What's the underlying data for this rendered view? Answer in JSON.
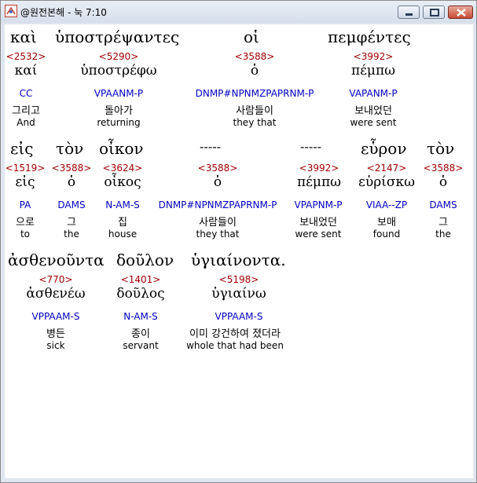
{
  "window": {
    "title": "@원전본해 - 눅 7:10",
    "buttons": {
      "minimize": "minimize",
      "maximize": "maximize",
      "close": "close"
    }
  },
  "rows": [
    {
      "words": [
        {
          "surface": "καὶ",
          "strong": "<2532>",
          "lemma": "καί",
          "morph": "CC",
          "korean": "그리고",
          "english": "And"
        },
        {
          "surface": "ὑποστρέψαντες",
          "strong": "<5290>",
          "lemma": "ὑποστρέφω",
          "morph": "VPAANM-P",
          "korean": "돌아가",
          "english": "returning"
        },
        {
          "surface": "οἱ",
          "strong": "<3588>",
          "lemma": "ὁ",
          "morph": "DNMP#NPNMZPAPRNM-P",
          "korean": "사람들이",
          "english": "they that"
        },
        {
          "surface": "πεμφέντες",
          "strong": "<3992>",
          "lemma": "πέμπω",
          "morph": "VAPANM-P",
          "korean": "보내었던",
          "english": "were sent"
        }
      ]
    },
    {
      "words": [
        {
          "surface": "εἰς",
          "strong": "<1519>",
          "lemma": "εἰς",
          "morph": "PA",
          "korean": "으로",
          "english": "to"
        },
        {
          "surface": "τὸν",
          "strong": "<3588>",
          "lemma": "ὁ",
          "morph": "DAMS",
          "korean": "그",
          "english": "the"
        },
        {
          "surface": "οἶκον",
          "strong": "<3624>",
          "lemma": "οἶκος",
          "morph": "N-AM-S",
          "korean": "집",
          "english": "house"
        },
        {
          "surface": "-----",
          "strong": "<3588>",
          "lemma": "ὁ",
          "morph": "DNMP#NPNMZPAPRNM-P",
          "korean": "사람들이",
          "english": "they that"
        },
        {
          "surface": "-----",
          "strong": "<3992>",
          "lemma": "πέμπω",
          "morph": "VPAPNM-P",
          "korean": "보내었던",
          "english": "were sent"
        },
        {
          "surface": "εὗρον",
          "strong": "<2147>",
          "lemma": "εὑρίσκω",
          "morph": "VIAA--ZP",
          "korean": "보매",
          "english": "found"
        },
        {
          "surface": "τὸν",
          "strong": "<3588>",
          "lemma": "ὁ",
          "morph": "DAMS",
          "korean": "그",
          "english": "the"
        }
      ]
    },
    {
      "words": [
        {
          "surface": "ἀσθενοῦντα",
          "strong": "<770>",
          "lemma": "ἀσθενέω",
          "morph": "VPPAAM-S",
          "korean": "병든",
          "english": "sick"
        },
        {
          "surface": "δοῦλον",
          "strong": "<1401>",
          "lemma": "δοῦλος",
          "morph": "N-AM-S",
          "korean": "종이",
          "english": "servant"
        },
        {
          "surface": "ὑγιαίνοντα.",
          "strong": "<5198>",
          "lemma": "ὑγιαίνω",
          "morph": "VPPAAM-S",
          "korean": "이미 강건하여 졌더라",
          "english": "whole that had been"
        }
      ]
    }
  ]
}
